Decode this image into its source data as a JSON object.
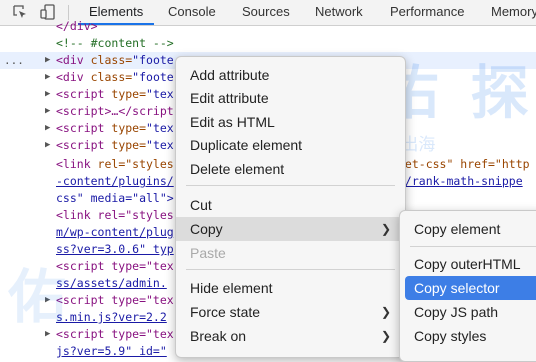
{
  "tabs": [
    "Elements",
    "Console",
    "Sources",
    "Network",
    "Performance",
    "Memory"
  ],
  "code": {
    "partial_top": "</div>",
    "comment": "<!-- #content -->",
    "lines": [
      {
        "dots": "...",
        "arrow": "▶",
        "tag_open": "<div ",
        "attr": "class=",
        "val": "\"foote"
      },
      {
        "arrow": "▶",
        "tag_open": "<div ",
        "attr": "class=",
        "val": "\"foote"
      },
      {
        "arrow": "▶",
        "tag_open": "<script ",
        "attr": "type=",
        "val": "\"tex"
      },
      {
        "arrow": "▶",
        "tag_open": "<script>",
        "attr": "…</script",
        "val": ""
      },
      {
        "arrow": "▶",
        "tag_open": "<script ",
        "attr": "type=",
        "val": "\"tex"
      },
      {
        "arrow": "▶",
        "tag_open": "<script ",
        "attr": "type=",
        "val": "\"tex"
      }
    ],
    "link1_a": "<link ",
    "link1_b": "rel=\"styles",
    "link1_right": "pet-css\" href=\"http",
    "link1_path": "-content/plugins/",
    "link1_path_right": "s/rank-math-snippe",
    "link1_css": "css\" media=\"all\">",
    "link2": "<link rel=\"styles",
    "link2_path": "m/wp-content/plug",
    "link2_ver": "ss?ver=3.0.6\" typ",
    "script7": "<script type=\"tex",
    "script7_path": "ss/assets/admin.",
    "script8": "<script type=\"tex",
    "script8_path": "s.min.js?ver=2.2",
    "script9": "<script type=\"tex",
    "script9_path": "js?ver=5.9\" id=\""
  },
  "watermark": {
    "big": "中 机 佑 探",
    "sub": "跨境服务跨境电商 助力中企出海"
  },
  "context_menu": {
    "items": [
      "Add attribute",
      "Edit attribute",
      "Edit as HTML",
      "Duplicate element",
      "Delete element",
      "Cut",
      "Copy",
      "Paste",
      "Hide element",
      "Force state",
      "Break on"
    ]
  },
  "copy_submenu": {
    "items": [
      "Copy element",
      "Copy outerHTML",
      "Copy selector",
      "Copy JS path",
      "Copy styles"
    ]
  },
  "colors": {
    "accent": "#1a73e8",
    "highlight": "#3d7ee6",
    "tag": "#881280",
    "attr": "#994500",
    "value": "#1a1aa6"
  }
}
